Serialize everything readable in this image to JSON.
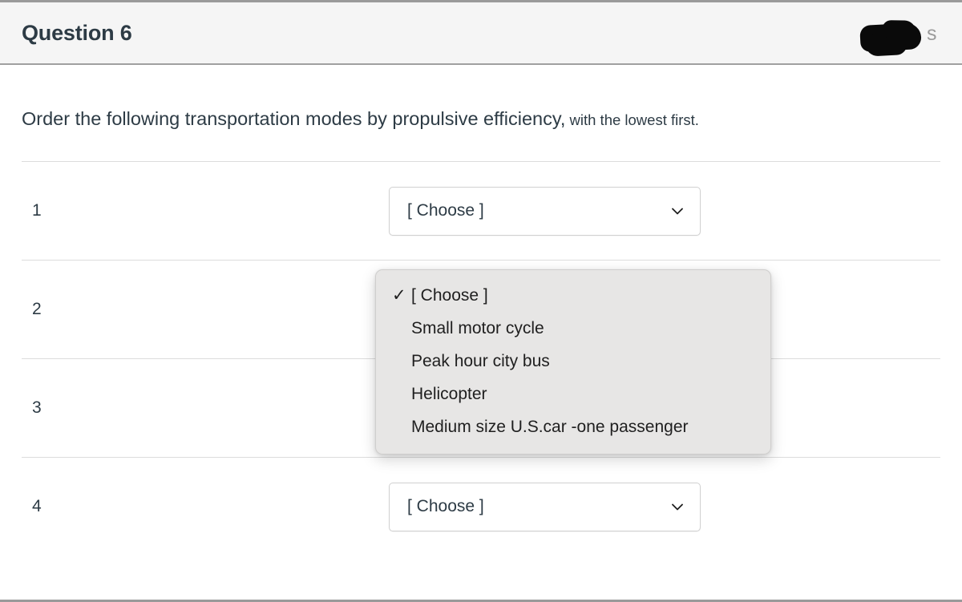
{
  "header": {
    "title": "Question 6",
    "points_text": "s",
    "redaction_name": "redacted-points-label"
  },
  "question": {
    "main_text": "Order the following transportation modes by propulsive efficiency,",
    "sub_text": " with the lowest first."
  },
  "rows": [
    {
      "index": "1",
      "value": "[ Choose ]",
      "open": true
    },
    {
      "index": "2",
      "value": "[ Choose ]",
      "open": false
    },
    {
      "index": "3",
      "value": "[ Choose ]",
      "open": false
    },
    {
      "index": "4",
      "value": "[ Choose ]",
      "open": false
    }
  ],
  "dropdown": {
    "selected": "[ Choose ]",
    "check_glyph": "✓",
    "options": [
      {
        "label": "[ Choose ]",
        "checked": true
      },
      {
        "label": "Small motor cycle",
        "checked": false
      },
      {
        "label": "Peak hour city bus",
        "checked": false
      },
      {
        "label": "Helicopter",
        "checked": false
      },
      {
        "label": "Medium size U.S.car -one passenger",
        "checked": false
      }
    ]
  },
  "colors": {
    "header_bg": "#f5f5f5",
    "page_bg": "#ffffff",
    "text": "#2d3b45",
    "popup_bg": "#e7e6e5",
    "divider": "#dcdcdc",
    "border": "#9a9a9a"
  }
}
